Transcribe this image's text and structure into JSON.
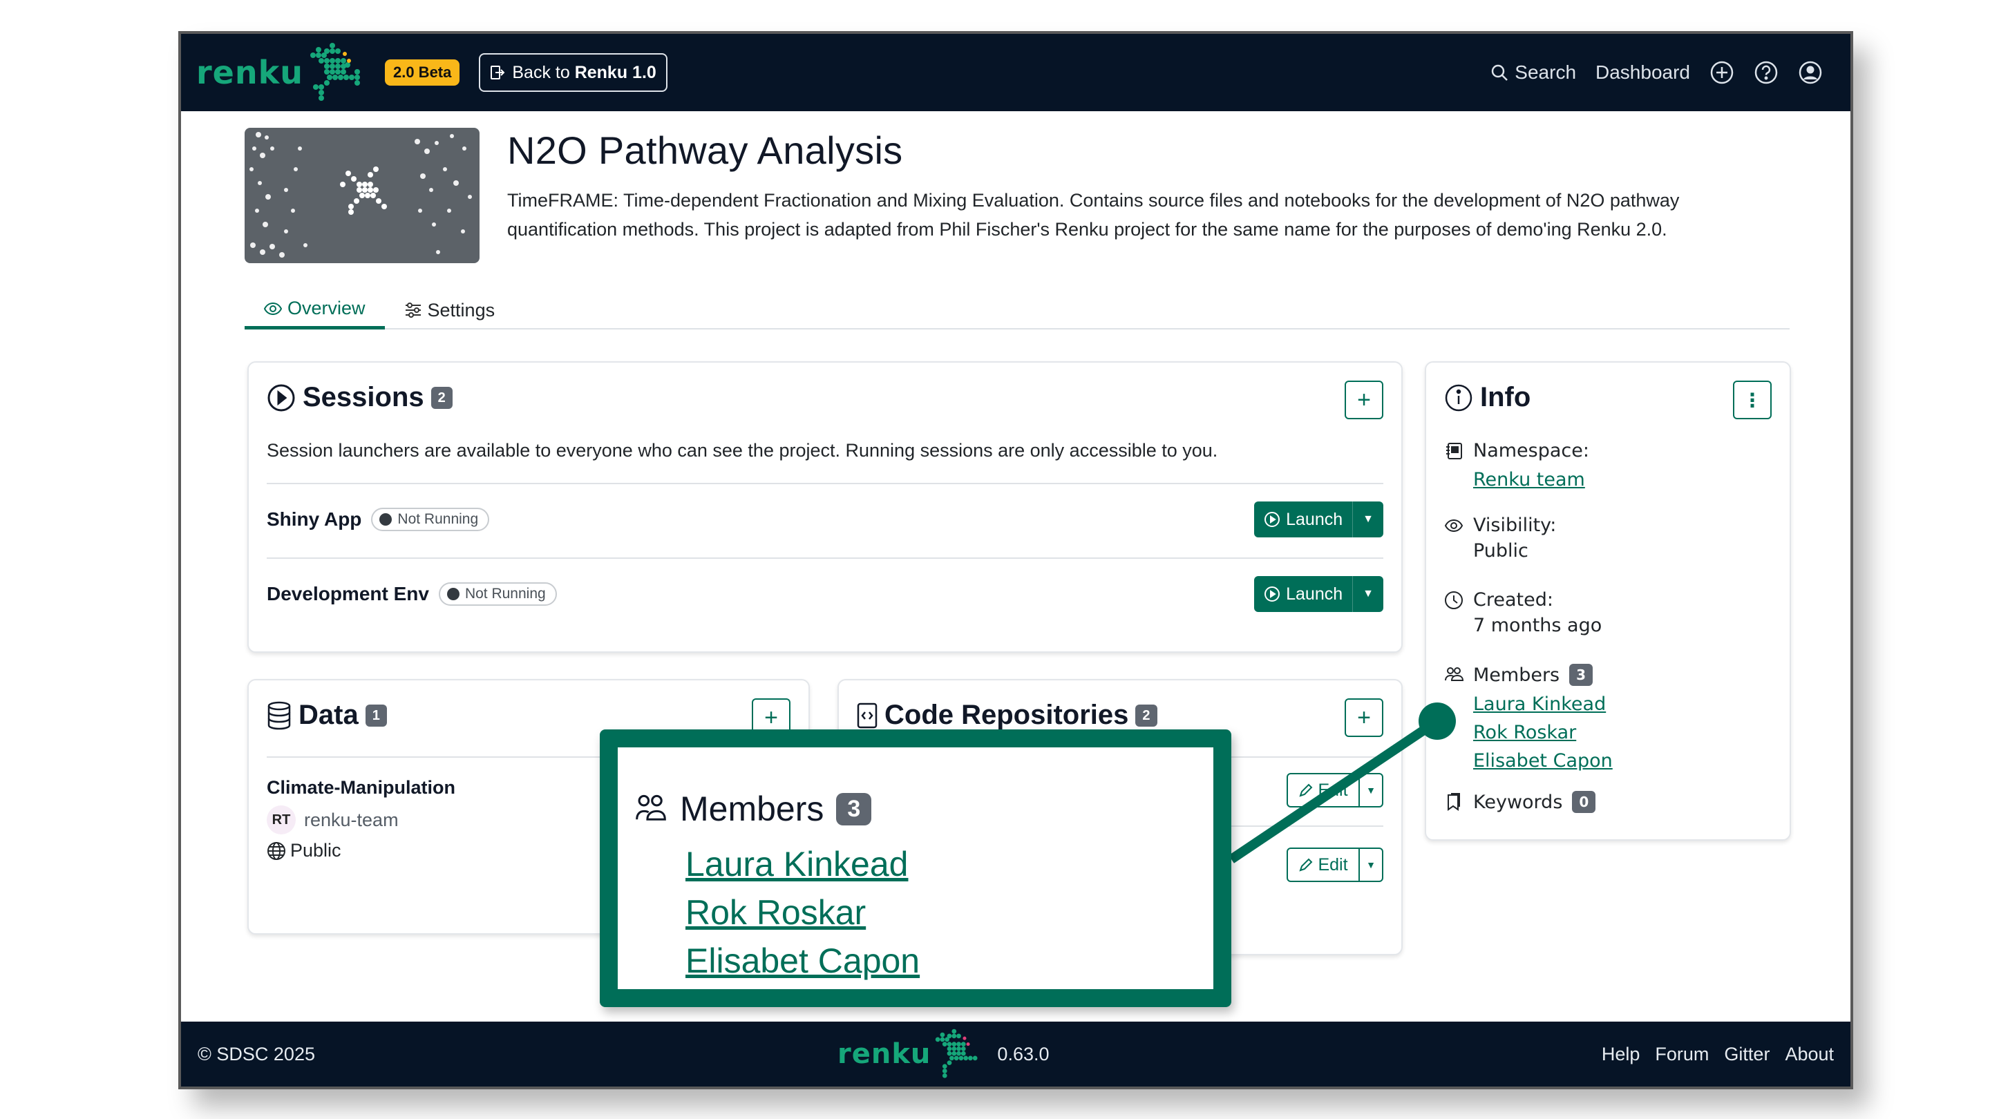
{
  "header": {
    "logo_text": "renku",
    "beta_badge": "2.0 Beta",
    "back_button": {
      "prefix": "Back to ",
      "bold": "Renku 1.0"
    },
    "nav": {
      "search": "Search",
      "dashboard": "Dashboard"
    },
    "icons": [
      "plus-circle-icon",
      "question-circle-icon",
      "user-circle-icon"
    ]
  },
  "project": {
    "title": "N2O Pathway Analysis",
    "description": "TimeFRAME: Time-dependent Fractionation and Mixing Evaluation. Contains source files and notebooks for the development of N2O pathway quantification methods. This project is adapted from Phil Fischer's Renku project for the same name for the purposes of demo'ing Renku 2.0."
  },
  "tabs": [
    {
      "label": "Overview",
      "active": true,
      "icon": "eye-icon"
    },
    {
      "label": "Settings",
      "active": false,
      "icon": "sliders-icon"
    }
  ],
  "sessions": {
    "title": "Sessions",
    "count": "2",
    "note": "Session launchers are available to everyone who can see the project. Running sessions are only accessible to you.",
    "items": [
      {
        "name": "Shiny App",
        "status": "Not Running",
        "action": "Launch"
      },
      {
        "name": "Development Env",
        "status": "Not Running",
        "action": "Launch"
      }
    ]
  },
  "data": {
    "title": "Data",
    "count": "1",
    "items": [
      {
        "name": "Climate-Manipulation",
        "owner_initials": "RT",
        "owner": "renku-team",
        "visibility": "Public"
      }
    ]
  },
  "code_repositories": {
    "title": "Code Repositories",
    "count": "2",
    "edit_label": "Edit"
  },
  "info": {
    "title": "Info",
    "namespace_label": "Namespace:",
    "namespace_value": "Renku team",
    "visibility_label": "Visibility:",
    "visibility_value": "Public",
    "created_label": "Created:",
    "created_value": "7 months ago",
    "members_label": "Members",
    "members_count": "3",
    "members": [
      "Laura Kinkead",
      "Rok Roskar",
      "Elisabet Capon"
    ],
    "keywords_label": "Keywords",
    "keywords_count": "0"
  },
  "callout": {
    "label": "Members",
    "count": "3",
    "members": [
      "Laura Kinkead",
      "Rok Roskar",
      "Elisabet Capon"
    ]
  },
  "footer": {
    "copyright": "© SDSC 2025",
    "logo_text": "renku",
    "version": "0.63.0",
    "links": [
      "Help",
      "Forum",
      "Gitter",
      "About"
    ]
  },
  "colors": {
    "brand_green": "#006e58",
    "header_bg": "#061426",
    "beta_yellow": "#f9b719",
    "badge_gray": "#5f6670"
  }
}
